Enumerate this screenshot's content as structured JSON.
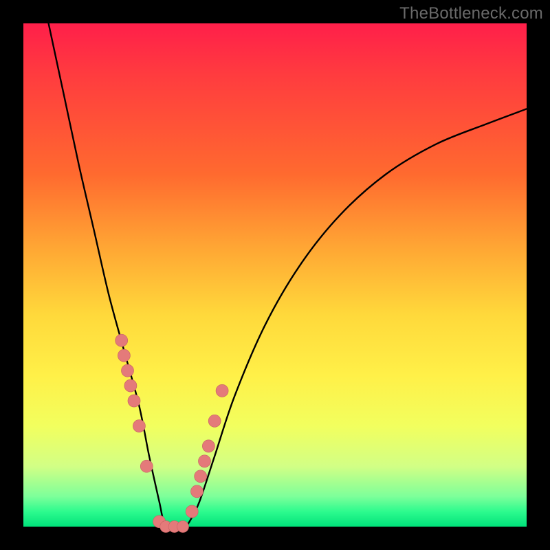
{
  "watermark": "TheBottleneck.com",
  "colors": {
    "background": "#000000",
    "gradient_top": "#ff1f4a",
    "gradient_bottom": "#00e27a",
    "curve": "#000000",
    "dot_fill": "#e47a7a",
    "dot_stroke": "#c96565"
  },
  "chart_data": {
    "type": "line",
    "title": "",
    "xlabel": "",
    "ylabel": "",
    "xlim": [
      0,
      100
    ],
    "ylim": [
      0,
      100
    ],
    "note": "Bottleneck-style V-curve; axes are normalized 0–100 since the source image has no tick labels. y≈100 is worst (red), y≈0 is best (green). Valley floor near x≈27–33.",
    "series": [
      {
        "name": "bottleneck-curve",
        "x": [
          5,
          8,
          11,
          14,
          17,
          20,
          23,
          25,
          27,
          28,
          30,
          32,
          33,
          35,
          38,
          42,
          48,
          55,
          63,
          72,
          82,
          92,
          100
        ],
        "y": [
          100,
          86,
          72,
          59,
          46,
          35,
          24,
          14,
          5,
          1,
          0,
          0,
          1,
          5,
          14,
          26,
          40,
          52,
          62,
          70,
          76,
          80,
          83
        ]
      }
    ],
    "highlight_dots": {
      "name": "sample-markers",
      "left_branch": {
        "x": [
          19.5,
          20,
          20.7,
          21.3,
          22,
          23,
          24.5,
          27
        ],
        "y": [
          37,
          34,
          31,
          28,
          25,
          20,
          12,
          1
        ]
      },
      "valley": {
        "x": [
          28.3,
          30,
          31.7
        ],
        "y": [
          0,
          0,
          0
        ]
      },
      "right_branch": {
        "x": [
          33.5,
          34.5,
          35.2,
          36,
          36.8,
          38,
          39.5
        ],
        "y": [
          3,
          7,
          10,
          13,
          16,
          21,
          27
        ]
      }
    }
  }
}
